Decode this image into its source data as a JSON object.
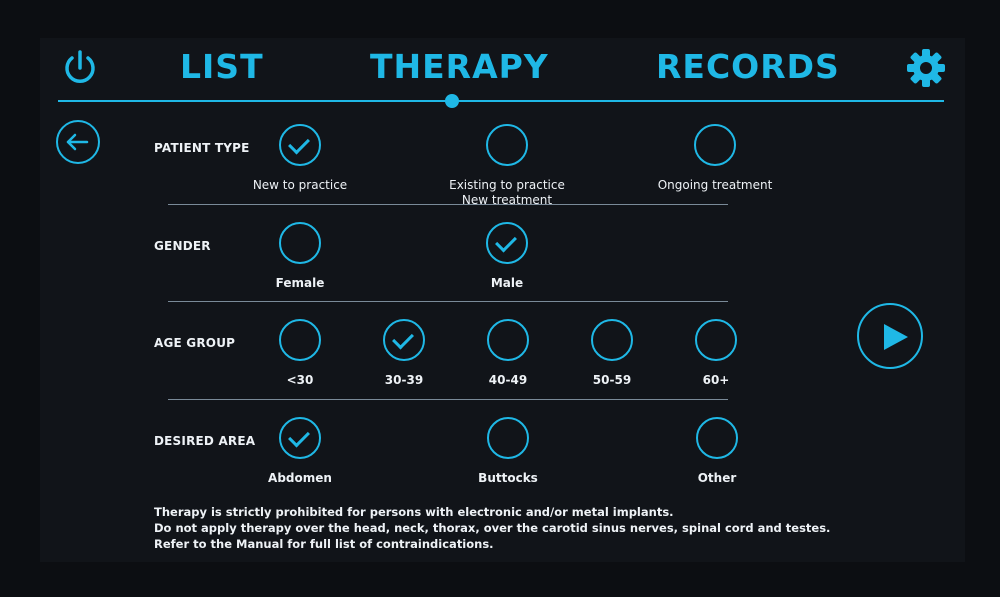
{
  "colors": {
    "accent": "#1fb8e6",
    "background": "#111419",
    "text": "#eef2f6"
  },
  "header": {
    "icons": {
      "power": "power-icon",
      "settings": "gear-icon"
    },
    "tabs": [
      {
        "label": "LIST"
      },
      {
        "label": "THERAPY",
        "active": true
      },
      {
        "label": "RECORDS"
      }
    ]
  },
  "back": {
    "icon": "arrow-left-icon"
  },
  "patient_type": {
    "label": "PATIENT TYPE",
    "options": [
      {
        "label": "New to practice",
        "checked": true
      },
      {
        "label": "Existing to practice\nNew treatment",
        "checked": false
      },
      {
        "label": "Ongoing treatment",
        "checked": false
      }
    ]
  },
  "gender": {
    "label": "GENDER",
    "options": [
      {
        "label": "Female",
        "checked": false
      },
      {
        "label": "Male",
        "checked": true
      }
    ]
  },
  "age_group": {
    "label": "AGE GROUP",
    "options": [
      {
        "label": "<30",
        "checked": false
      },
      {
        "label": "30-39",
        "checked": true
      },
      {
        "label": "40-49",
        "checked": false
      },
      {
        "label": "50-59",
        "checked": false
      },
      {
        "label": "60+",
        "checked": false
      }
    ]
  },
  "desired_area": {
    "label": "DESIRED AREA",
    "options": [
      {
        "label": "Abdomen",
        "checked": true
      },
      {
        "label": "Buttocks",
        "checked": false
      },
      {
        "label": "Other",
        "checked": false
      }
    ]
  },
  "play": {
    "icon": "play-icon"
  },
  "warning": [
    "Therapy is strictly prohibited for persons with electronic and/or metal implants.",
    "Do not apply therapy over the head, neck, thorax, over the carotid sinus nerves, spinal cord and testes.",
    "Refer to the Manual for full list of contraindications."
  ]
}
